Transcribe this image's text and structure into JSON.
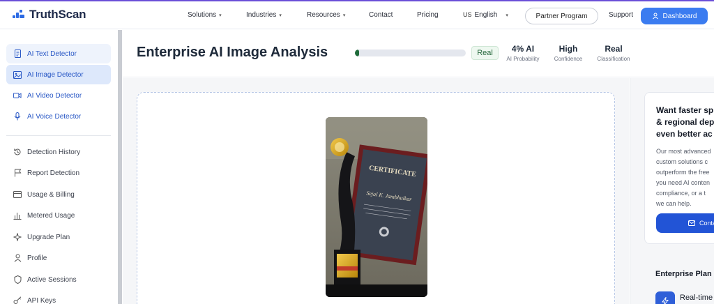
{
  "brand": {
    "name": "TruthScan",
    "accent_color": "#3b7cf0"
  },
  "nav": {
    "items": [
      {
        "label": "Solutions",
        "dropdown": true
      },
      {
        "label": "Industries",
        "dropdown": true
      },
      {
        "label": "Resources",
        "dropdown": true
      },
      {
        "label": "Contact",
        "dropdown": false
      },
      {
        "label": "Pricing",
        "dropdown": false
      }
    ],
    "language": {
      "code": "US",
      "label": "English"
    },
    "partner_label": "Partner Program",
    "support_label": "Support",
    "dashboard_label": "Dashboard"
  },
  "sidebar": {
    "detectors": [
      {
        "label": "AI Text Detector",
        "icon": "document-icon"
      },
      {
        "label": "AI Image Detector",
        "icon": "image-icon"
      },
      {
        "label": "AI Video Detector",
        "icon": "video-icon"
      },
      {
        "label": "AI Voice Detector",
        "icon": "microphone-icon"
      }
    ],
    "tools": [
      {
        "label": "Detection History",
        "icon": "history-icon"
      },
      {
        "label": "Report Detection",
        "icon": "flag-icon"
      },
      {
        "label": "Usage & Billing",
        "icon": "card-icon"
      },
      {
        "label": "Metered Usage",
        "icon": "bar-chart-icon"
      },
      {
        "label": "Upgrade Plan",
        "icon": "sparkle-icon"
      },
      {
        "label": "Profile",
        "icon": "user-icon"
      },
      {
        "label": "Active Sessions",
        "icon": "shield-icon"
      },
      {
        "label": "API Keys",
        "icon": "key-icon"
      }
    ]
  },
  "analysis": {
    "title": "Enterprise AI Image Analysis",
    "ai_fraction": 0.04,
    "badge": "Real",
    "stats": [
      {
        "value": "4% AI",
        "label": "AI Probability"
      },
      {
        "value": "High",
        "label": "Confidence"
      },
      {
        "value": "Real",
        "label": "Classification"
      }
    ]
  },
  "promo": {
    "title_lines": [
      "Want faster sp",
      "& regional dep",
      "even better ac"
    ],
    "text_lines": [
      "Our most advanced",
      "custom solutions c",
      "outperform the free",
      "you need AI conten",
      "compliance, or a t",
      "we can help."
    ],
    "button_label": "Conta",
    "enterprise_title": "Enterprise Plan",
    "feature_label": "Real-time"
  }
}
